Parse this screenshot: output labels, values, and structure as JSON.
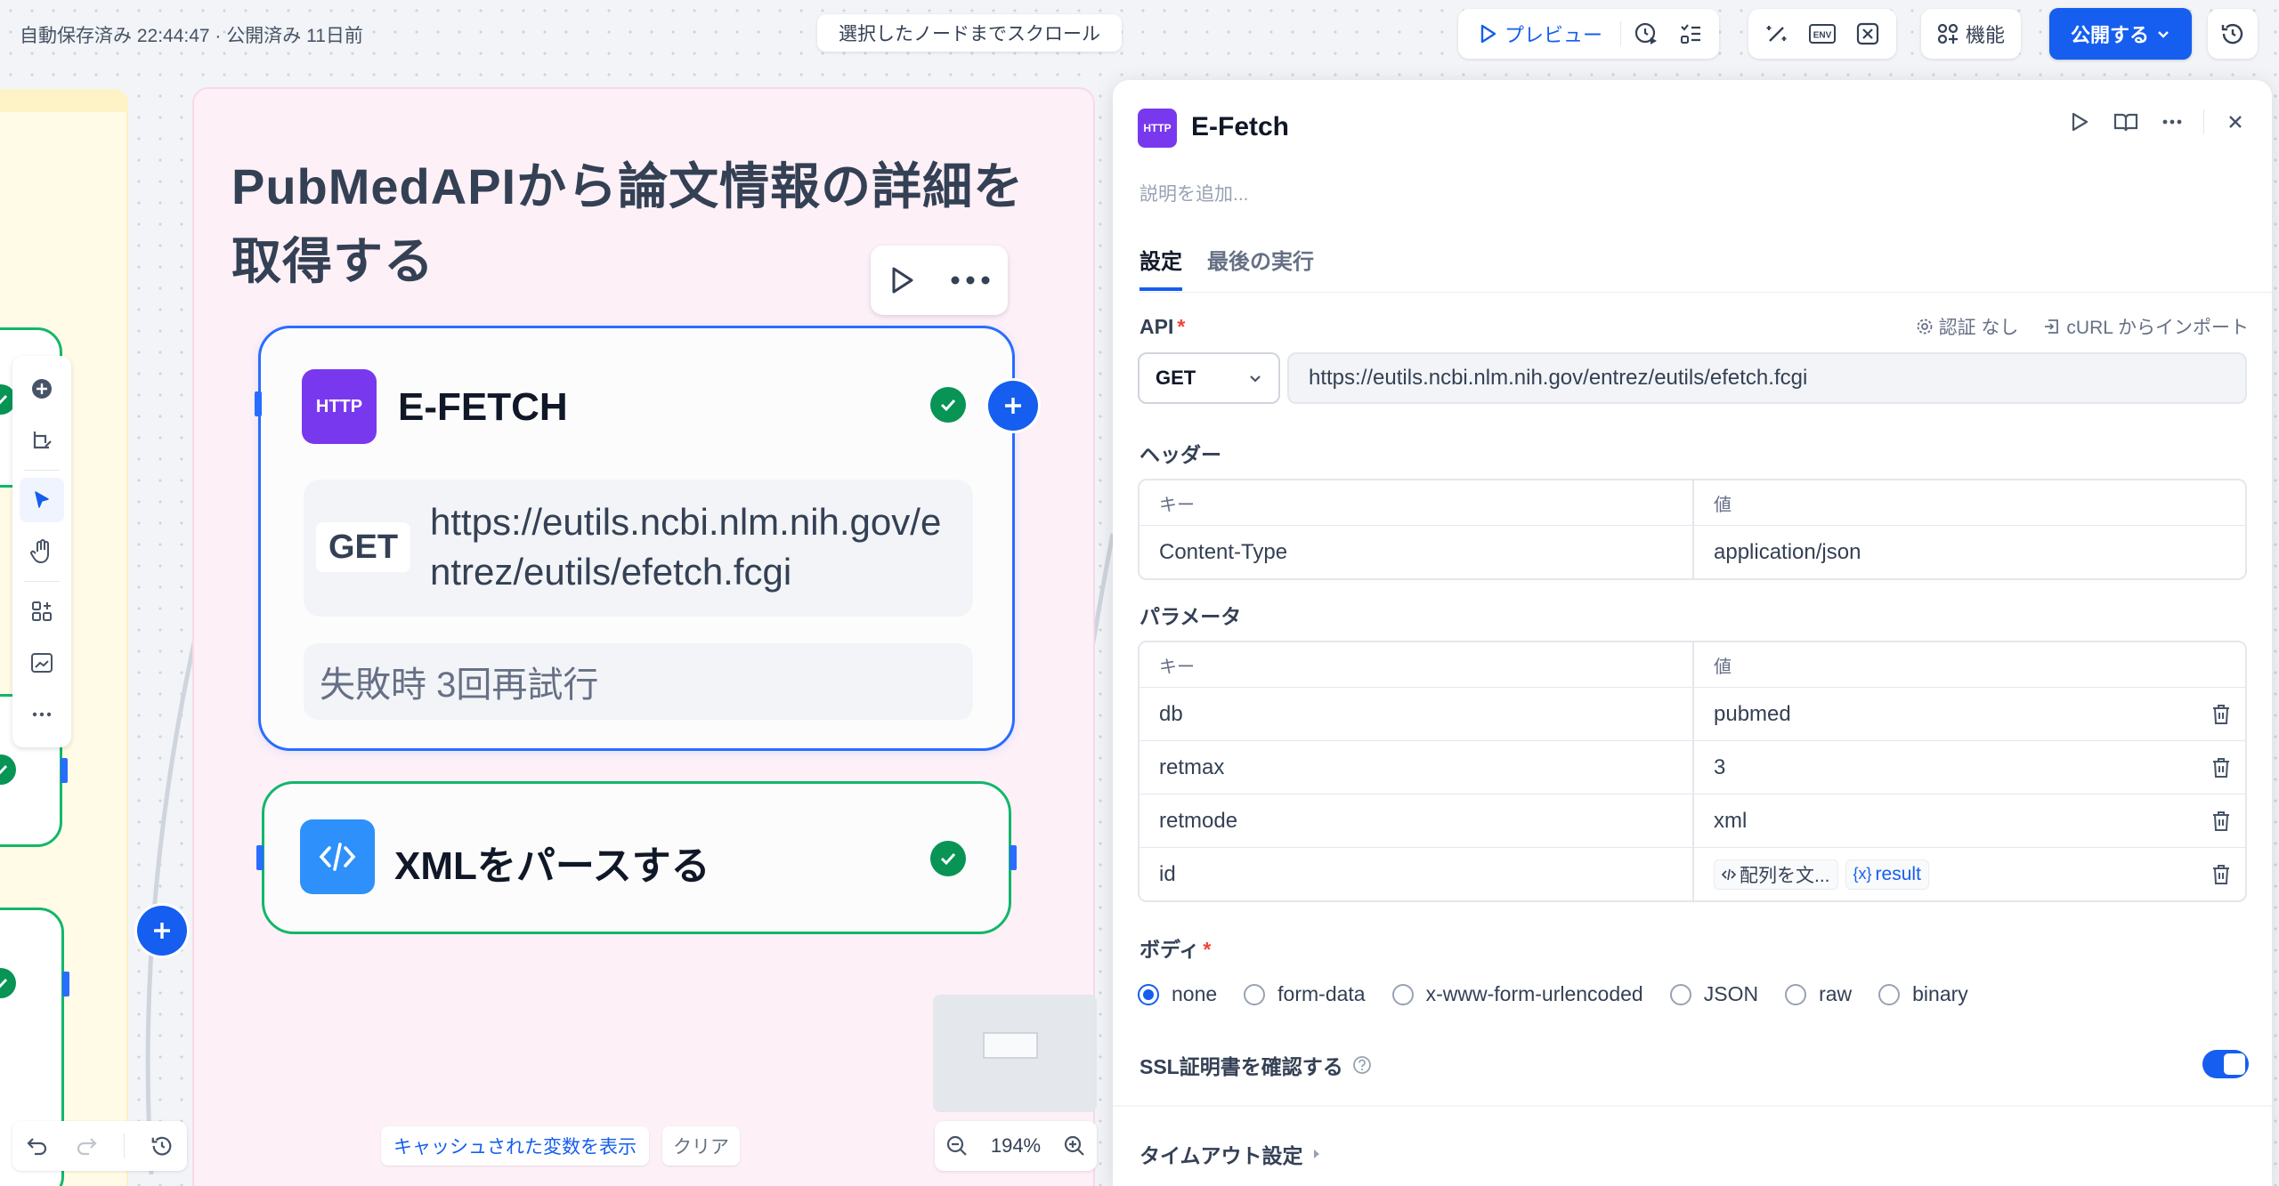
{
  "topbar": {
    "autosave": "自動保存済み 22:44:47 · 公開済み 11日前",
    "scroll_to_node": "選択したノードまでスクロール",
    "preview": "プレビュー",
    "features": "機能",
    "publish": "公開する",
    "env_label": "ENV"
  },
  "group": {
    "title": "PubMedAPIから論文情報の詳細を取得する"
  },
  "http_node": {
    "icon_text": "HTTP",
    "title": "E-FETCH",
    "method": "GET",
    "url": "https://eutils.ncbi.nlm.nih.gov/entrez/eutils/efetch.fcgi",
    "retry": "失敗時 3回再試行"
  },
  "xml_node": {
    "title": "XMLをパースする"
  },
  "bottom": {
    "show_cached": "キャッシュされた変数を表示",
    "clear": "クリア",
    "zoom": "194%"
  },
  "panel": {
    "icon_text": "HTTP",
    "title": "E-Fetch",
    "description_placeholder": "説明を追加...",
    "tabs": [
      {
        "label": "設定",
        "active": true
      },
      {
        "label": "最後の実行",
        "active": false
      }
    ],
    "api": {
      "label": "API",
      "auth": "認証 なし",
      "curl_import": "cURL からインポート",
      "method": "GET",
      "url": "https://eutils.ncbi.nlm.nih.gov/entrez/eutils/efetch.fcgi"
    },
    "headers": {
      "label": "ヘッダー",
      "key_col": "キー",
      "value_col": "値",
      "rows": [
        {
          "key": "Content-Type",
          "value": "application/json"
        }
      ]
    },
    "params": {
      "label": "パラメータ",
      "key_col": "キー",
      "value_col": "値",
      "rows": [
        {
          "key": "db",
          "value": "pubmed"
        },
        {
          "key": "retmax",
          "value": "3"
        },
        {
          "key": "retmode",
          "value": "xml"
        },
        {
          "key": "id",
          "value_chip1": "配列を文...",
          "value_chip2": "result"
        }
      ]
    },
    "body": {
      "label": "ボディ",
      "options": [
        "none",
        "form-data",
        "x-www-form-urlencoded",
        "JSON",
        "raw",
        "binary"
      ],
      "selected": "none"
    },
    "ssl": {
      "label": "SSL証明書を確認する",
      "enabled": true
    },
    "timeout": {
      "label": "タイムアウト設定"
    }
  },
  "colors": {
    "accent": "#155eef",
    "success": "#079455",
    "http_icon": "#7839ee",
    "code_icon": "#2e90fa",
    "group_bg": "#fdf0f7"
  }
}
